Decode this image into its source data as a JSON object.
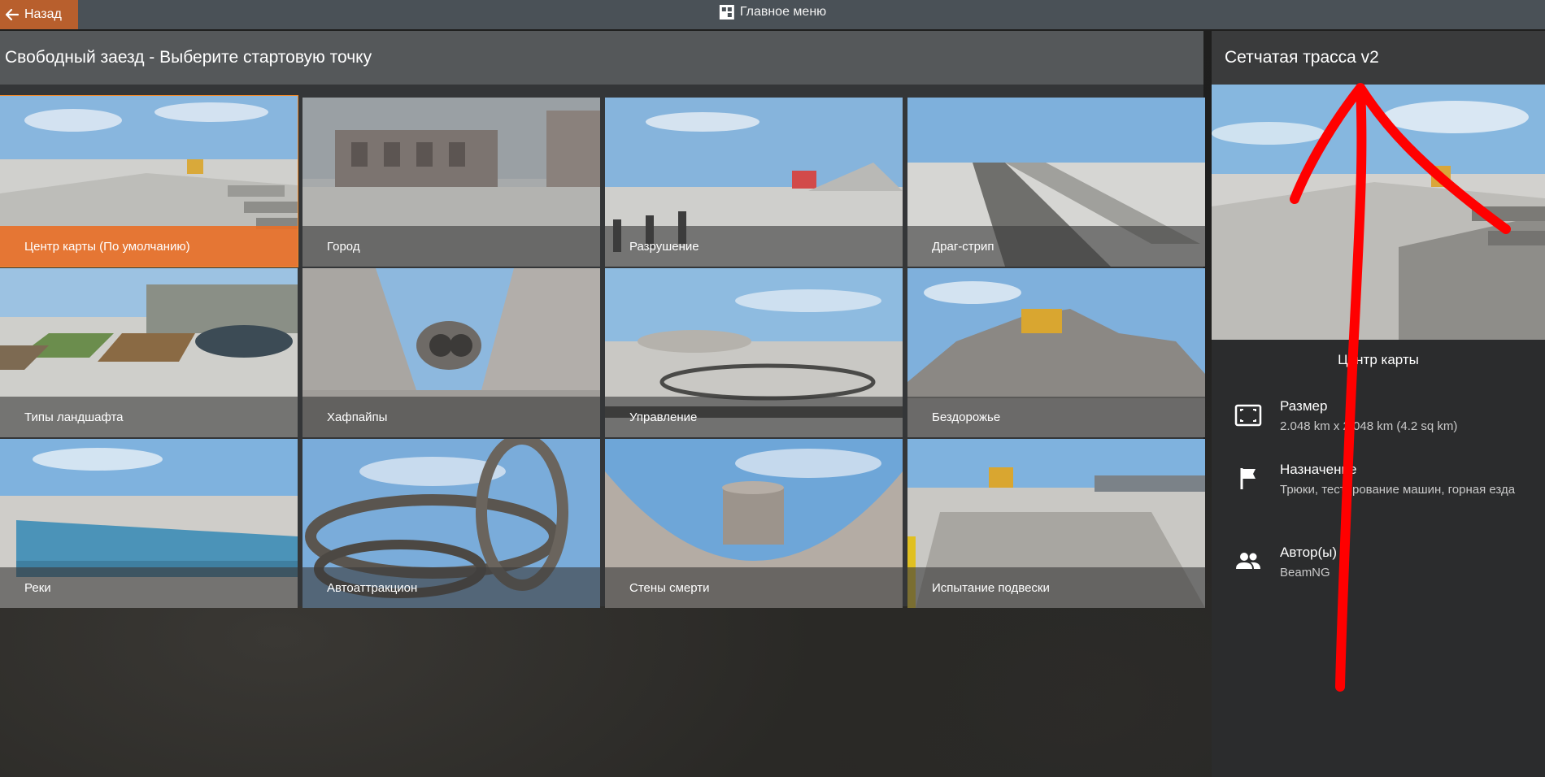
{
  "topbar": {
    "back_label": "Назад",
    "main_menu_label": "Главное меню"
  },
  "panel": {
    "title": "Свободный заезд - Выберите стартовую точку"
  },
  "tiles": [
    {
      "label": "Центр карты (По умолчанию)",
      "selected": true
    },
    {
      "label": "Город"
    },
    {
      "label": "Разрушение"
    },
    {
      "label": "Драг-стрип"
    },
    {
      "label": "Типы ландшафта"
    },
    {
      "label": "Хафпайпы"
    },
    {
      "label": "Управление"
    },
    {
      "label": "Бездорожье"
    },
    {
      "label": "Реки"
    },
    {
      "label": "Автоаттракцион"
    },
    {
      "label": "Стены смерти"
    },
    {
      "label": "Испытание подвески"
    }
  ],
  "sidebar": {
    "title": "Сетчатая трасса v2",
    "preview_caption": "Центр карты",
    "size_title": "Размер",
    "size_value": "2.048 km x 2.048 km (4.2 sq km)",
    "purpose_title": "Назначение",
    "purpose_value": "Трюки, тестирование машин, горная езда",
    "authors_title": "Автор(ы)",
    "authors_value": "BeamNG"
  },
  "colors": {
    "accent": "#e87028",
    "annotation": "#ff0000"
  }
}
